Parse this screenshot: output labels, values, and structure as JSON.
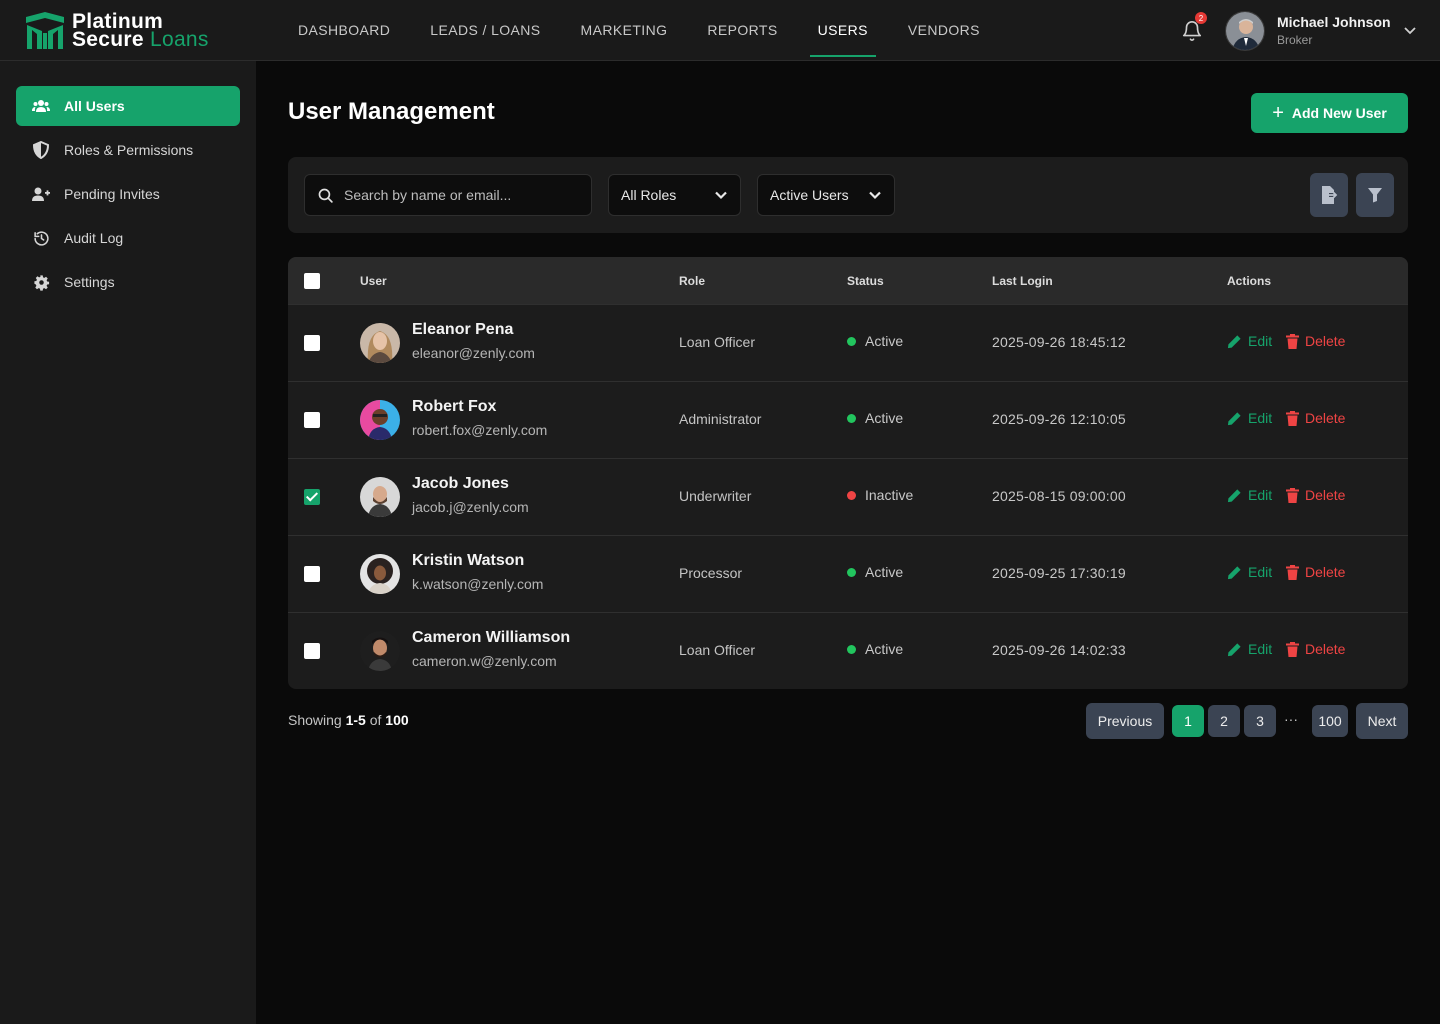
{
  "brand": {
    "line1": "Platinum",
    "line2_a": "Secure ",
    "line2_b": "Loans",
    "accent": "#16a36b"
  },
  "nav": {
    "items": [
      {
        "label": "DASHBOARD",
        "active": false
      },
      {
        "label": "LEADS / LOANS",
        "active": false
      },
      {
        "label": "MARKETING",
        "active": false
      },
      {
        "label": "REPORTS",
        "active": false
      },
      {
        "label": "USERS",
        "active": true
      },
      {
        "label": "VENDORS",
        "active": false
      }
    ]
  },
  "header": {
    "notification_count": "2",
    "user_name": "Michael Johnson",
    "user_role": "Broker"
  },
  "sidebar": {
    "items": [
      {
        "label": "All Users",
        "icon": "users-icon",
        "active": true
      },
      {
        "label": "Roles & Permissions",
        "icon": "shield-icon",
        "active": false
      },
      {
        "label": "Pending Invites",
        "icon": "user-plus-icon",
        "active": false
      },
      {
        "label": "Audit Log",
        "icon": "history-icon",
        "active": false
      },
      {
        "label": "Settings",
        "icon": "gear-icon",
        "active": false
      }
    ]
  },
  "main": {
    "title": "User Management",
    "add_button": "Add New User"
  },
  "filters": {
    "search_placeholder": "Search by name or email...",
    "role_select": "All Roles",
    "status_select": "Active Users"
  },
  "table": {
    "columns": [
      "User",
      "Role",
      "Status",
      "Last Login",
      "Actions"
    ],
    "edit_label": "Edit",
    "delete_label": "Delete",
    "rows": [
      {
        "name": "Eleanor Pena",
        "email": "eleanor@zenly.com",
        "role": "Loan Officer",
        "status": "Active",
        "last_login": "2025-09-26 18:45:12",
        "checked": false
      },
      {
        "name": "Robert Fox",
        "email": "robert.fox@zenly.com",
        "role": "Administrator",
        "status": "Active",
        "last_login": "2025-09-26 12:10:05",
        "checked": false
      },
      {
        "name": "Jacob Jones",
        "email": "jacob.j@zenly.com",
        "role": "Underwriter",
        "status": "Inactive",
        "last_login": "2025-08-15 09:00:00",
        "checked": true
      },
      {
        "name": "Kristin Watson",
        "email": "k.watson@zenly.com",
        "role": "Processor",
        "status": "Active",
        "last_login": "2025-09-25 17:30:19",
        "checked": false
      },
      {
        "name": "Cameron Williamson",
        "email": "cameron.w@zenly.com",
        "role": "Loan Officer",
        "status": "Active",
        "last_login": "2025-09-26 14:02:33",
        "checked": false
      }
    ]
  },
  "colors": {
    "active": "#22c55e",
    "inactive": "#ef4444",
    "primary": "#16a36b"
  },
  "pagination": {
    "showing_prefix": "Showing ",
    "range": "1-5",
    "of": " of ",
    "total": "100",
    "previous": "Previous",
    "next": "Next",
    "pages": [
      "1",
      "2",
      "3",
      "100"
    ],
    "ellipsis": "···",
    "current_page": "1"
  }
}
